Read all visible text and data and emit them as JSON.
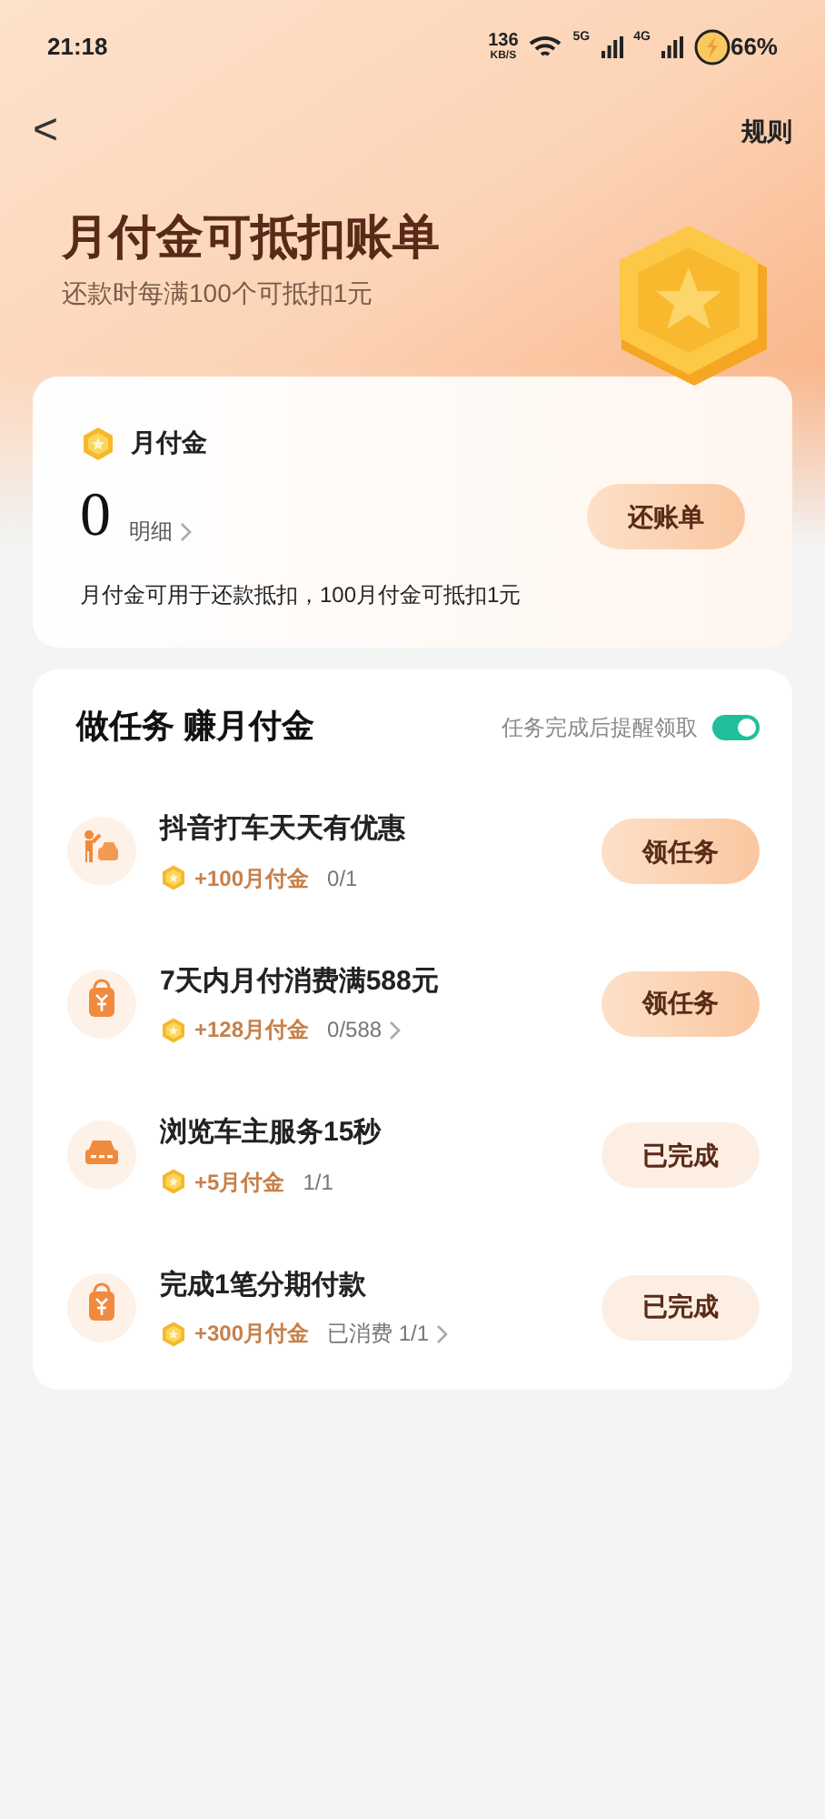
{
  "status_bar": {
    "time": "21:18",
    "speed": "136",
    "speed_unit": "KB/S",
    "network_1": "5G",
    "network_2": "4G",
    "battery": "66%"
  },
  "nav": {
    "back": "<",
    "rules": "规则"
  },
  "banner": {
    "title": "月付金可抵扣账单",
    "subtitle": "还款时每满100个可抵扣1元"
  },
  "balance_card": {
    "label": "月付金",
    "amount": "0",
    "detail_link": "明细",
    "button": "还账单",
    "note": "月付金可用于还款抵扣，100月付金可抵扣1元"
  },
  "tasks_card": {
    "title": "做任务 赚月付金",
    "reminder_label": "任务完成后提醒领取",
    "reminder_on": true,
    "tasks": [
      {
        "kind": "taxi",
        "title": "抖音打车天天有优惠",
        "reward": "+100月付金",
        "progress": "0/1",
        "has_chevron": false,
        "button": "领任务",
        "completed": false
      },
      {
        "kind": "bag",
        "title": "7天内月付消费满588元",
        "reward": "+128月付金",
        "progress": "0/588",
        "has_chevron": true,
        "button": "领任务",
        "completed": false
      },
      {
        "kind": "car",
        "title": "浏览车主服务15秒",
        "reward": "+5月付金",
        "progress": "1/1",
        "has_chevron": false,
        "button": "已完成",
        "completed": true
      },
      {
        "kind": "bag",
        "title": "完成1笔分期付款",
        "reward": "+300月付金",
        "progress": "已消费 1/1",
        "has_chevron": true,
        "button": "已完成",
        "completed": true
      }
    ]
  }
}
